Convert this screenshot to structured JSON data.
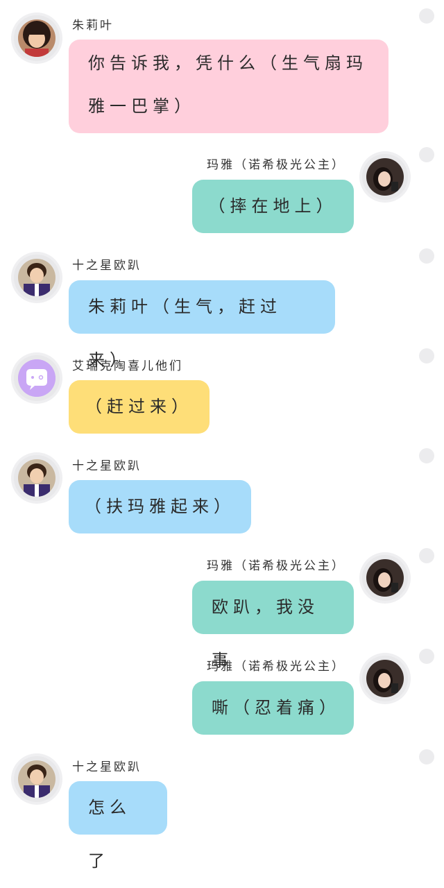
{
  "colors": {
    "pink": "#ffcfdc",
    "teal": "#8cdacd",
    "blue": "#a7dcfa",
    "yellow": "#fede78",
    "dot": "#ececee"
  },
  "messages": [
    {
      "side": "left",
      "speaker": "朱莉叶",
      "avatar_icon": "julie-avatar-icon",
      "text_lines": [
        "你告诉我，凭什么（生气扇玛",
        "雅一巴掌）"
      ],
      "color": "pink"
    },
    {
      "side": "right",
      "speaker": "玛雅（诺希极光公主）",
      "avatar_icon": "maya-avatar-icon",
      "text_lines": [
        "（摔在地上）"
      ],
      "color": "teal"
    },
    {
      "side": "left",
      "speaker": "十之星欧趴",
      "avatar_icon": "opa-avatar-icon",
      "text_lines": [
        "朱莉叶（生气，赶过来）"
      ],
      "color": "blue"
    },
    {
      "side": "left",
      "speaker": "艾瑞克陶喜儿他们",
      "avatar_icon": "chat-bubble-avatar-icon",
      "text_lines": [
        "（赶过来）"
      ],
      "color": "yellow"
    },
    {
      "side": "left",
      "speaker": "十之星欧趴",
      "avatar_icon": "opa-avatar-icon",
      "text_lines": [
        "（扶玛雅起来）"
      ],
      "color": "blue"
    },
    {
      "side": "right",
      "speaker": "玛雅（诺希极光公主）",
      "avatar_icon": "maya-avatar-icon",
      "text_lines": [
        "欧趴，我没事"
      ],
      "color": "teal"
    },
    {
      "side": "right",
      "speaker": "玛雅（诺希极光公主）",
      "avatar_icon": "maya-avatar-icon",
      "text_lines": [
        "嘶（忍着痛）"
      ],
      "color": "teal"
    },
    {
      "side": "left",
      "speaker": "十之星欧趴",
      "avatar_icon": "opa-avatar-icon",
      "text_lines": [
        "怎么了"
      ],
      "color": "blue"
    }
  ]
}
